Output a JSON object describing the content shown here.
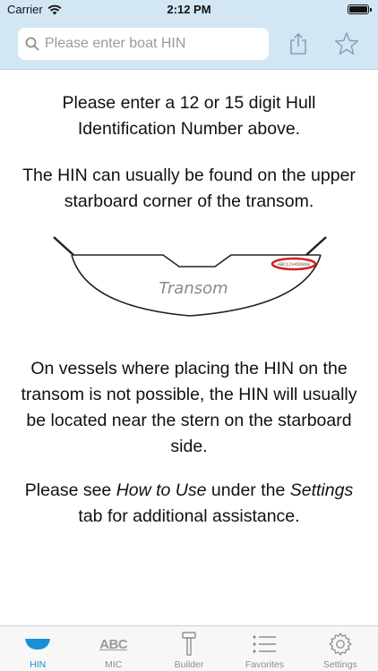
{
  "status": {
    "carrier": "Carrier",
    "time": "2:12 PM"
  },
  "search": {
    "placeholder": "Please enter boat HIN",
    "value": ""
  },
  "content": {
    "p1": "Please enter a 12 or 15 digit Hull Identification Number above.",
    "p2": "The HIN can usually be found on the upper starboard corner of the transom.",
    "transom_label": "Transom",
    "hin_plate_text": "ABC12345D899",
    "p3": "On vessels where placing the HIN on the transom is not possible, the HIN will usually be located near the stern on the starboard side.",
    "p4_a": "Please see ",
    "p4_em1": "How to Use",
    "p4_b": " under the ",
    "p4_em2": "Settings",
    "p4_c": " tab for additional assistance."
  },
  "tabs": [
    {
      "label": "HIN",
      "icon": "boat-icon",
      "active": true
    },
    {
      "label": "MIC",
      "icon": "abc-icon",
      "active": false,
      "glyph": "ABC"
    },
    {
      "label": "Builder",
      "icon": "hammer-icon",
      "active": false
    },
    {
      "label": "Favorites",
      "icon": "list-icon",
      "active": false
    },
    {
      "label": "Settings",
      "icon": "gear-icon",
      "active": false
    }
  ],
  "colors": {
    "header_bg": "#d3e6f3",
    "accent": "#1a8fd6",
    "inactive": "#8e8e8e",
    "hin_oval": "#d42020"
  }
}
